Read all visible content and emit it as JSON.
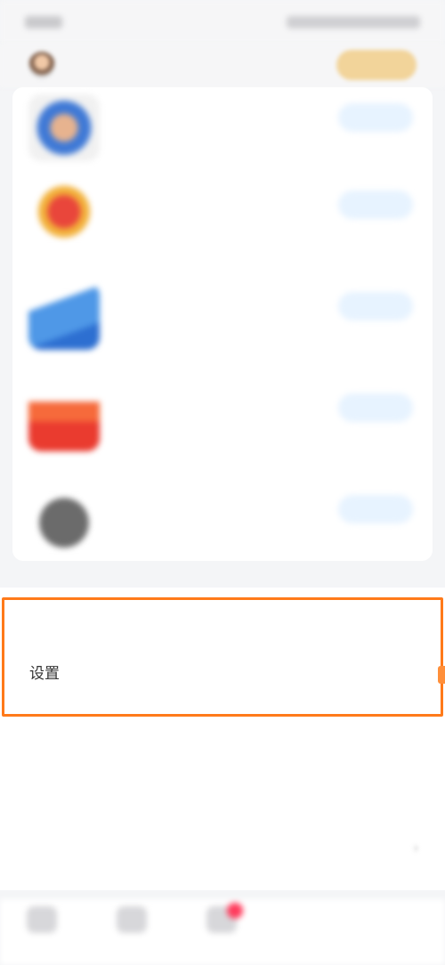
{
  "status_bar": {
    "left_text": "",
    "right_text": ""
  },
  "header": {
    "user_name": "",
    "vip_button_label": ""
  },
  "tasks": [
    {
      "title": "",
      "desc": "",
      "action": ""
    },
    {
      "title": "",
      "desc": "",
      "action": ""
    },
    {
      "title": "",
      "desc": "",
      "action": ""
    },
    {
      "title": "",
      "desc": "",
      "action": ""
    },
    {
      "title": "",
      "desc": "",
      "action": ""
    }
  ],
  "settings": {
    "rows": [
      {
        "label": "",
        "value": ""
      },
      {
        "label": "设置",
        "value": ""
      },
      {
        "label": "",
        "value": ""
      },
      {
        "label": "",
        "value": ""
      },
      {
        "label": "",
        "value": ""
      }
    ]
  },
  "bottom_nav": {
    "items": [
      {
        "label": "",
        "icon": "home-icon"
      },
      {
        "label": "",
        "icon": "box-icon"
      },
      {
        "label": "",
        "icon": "message-icon"
      }
    ]
  },
  "colors": {
    "highlight": "#ff7a1a",
    "task_action": "#4aa1f0",
    "vip": "#f2d49a",
    "badge": "#ff3b5c"
  }
}
